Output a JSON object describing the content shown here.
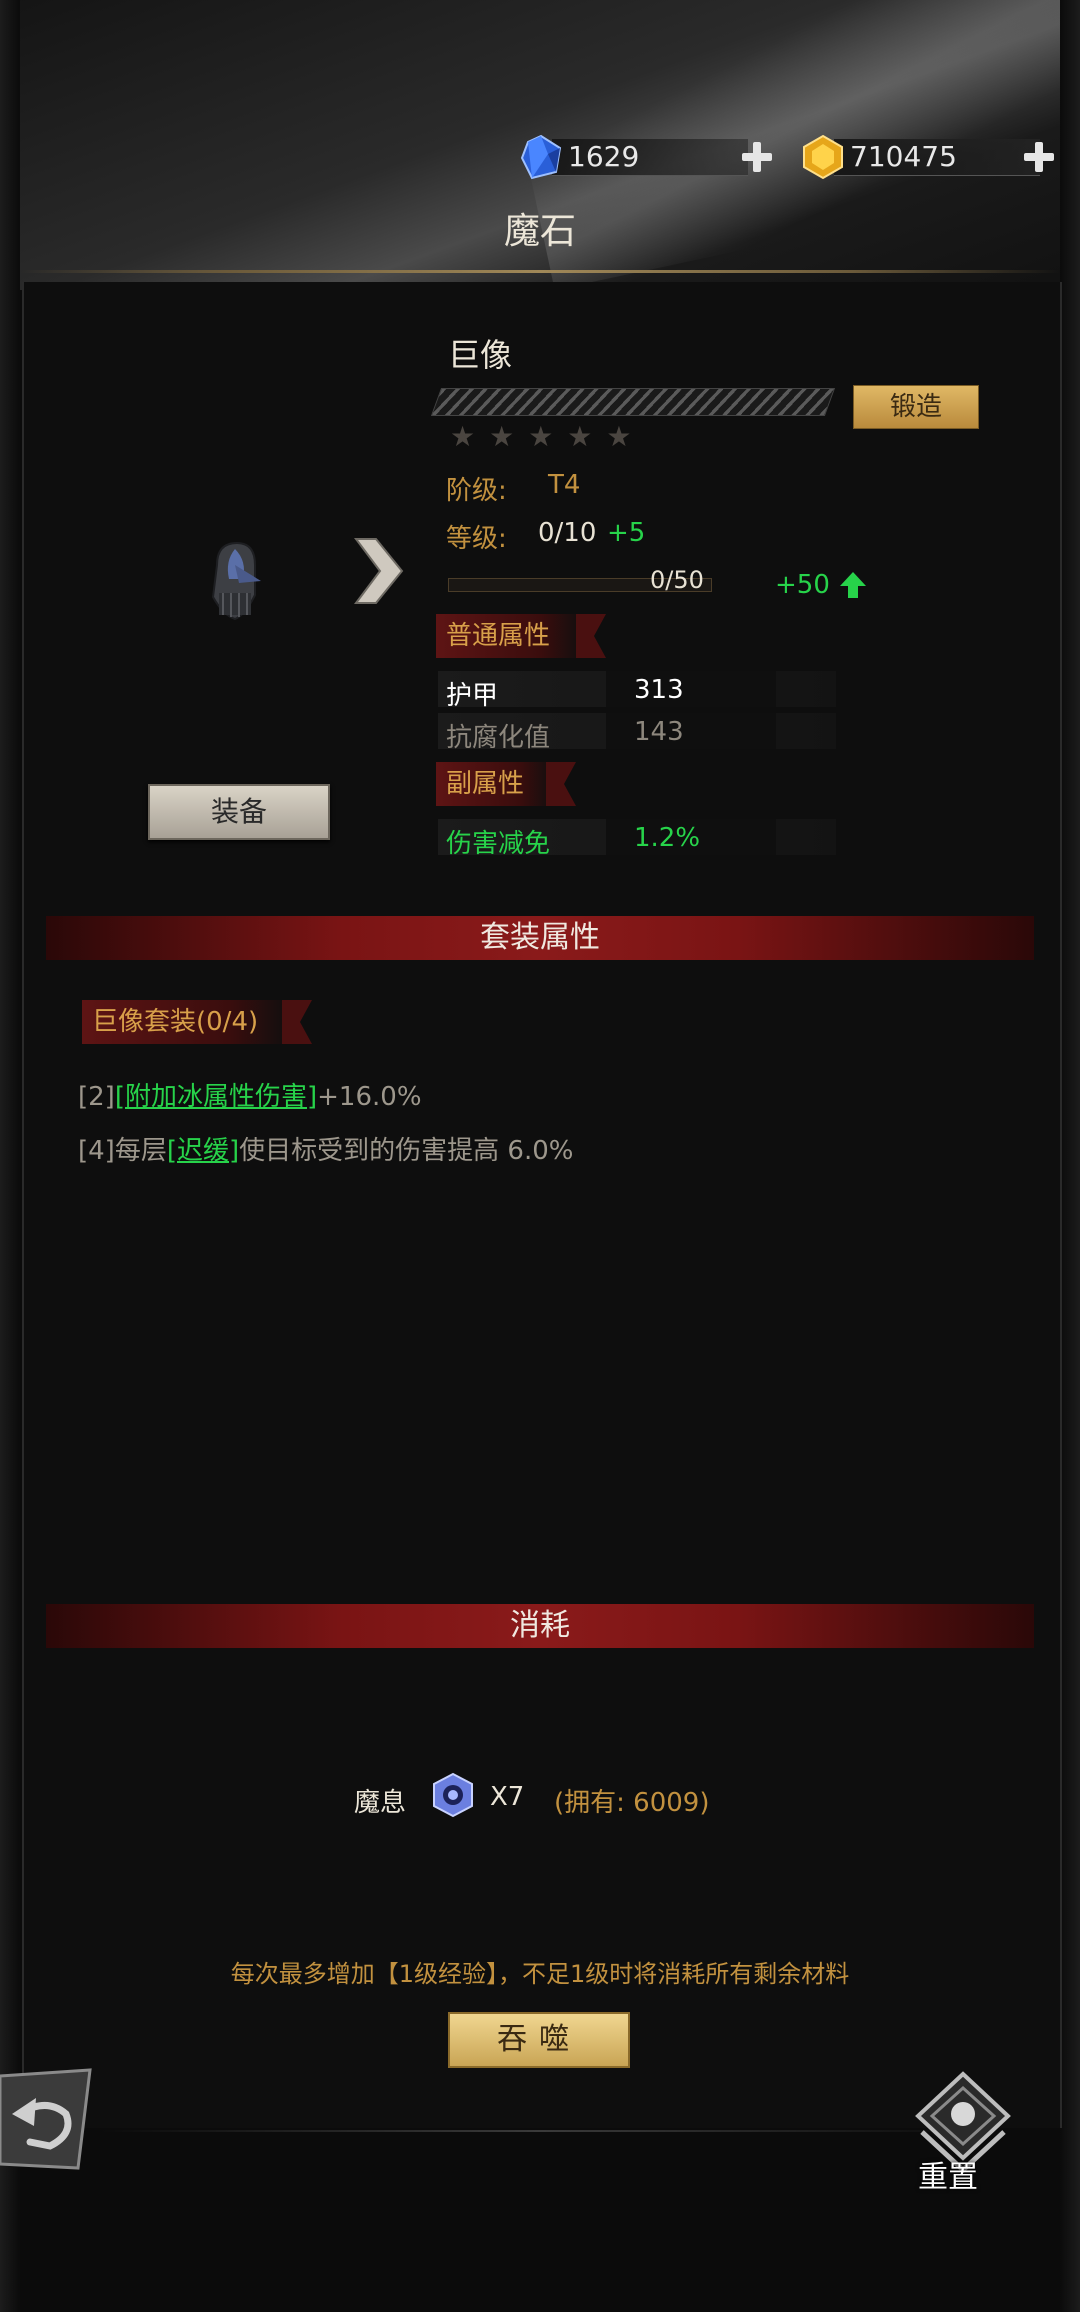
{
  "currency": {
    "gems": "1629",
    "gold": "710475"
  },
  "header": {
    "title": "魔石"
  },
  "item": {
    "name": "巨像",
    "forge_label": "锻造",
    "stars": "★★★★★",
    "tier_label": "阶级:",
    "tier_value": "T4",
    "level_label": "等级:",
    "level_value": "0/10",
    "level_bonus": "+5",
    "exp_text": "0/50",
    "exp_progress": 0,
    "exp_boost": "+50",
    "equip_label": "装备"
  },
  "normal_attrs": {
    "title": "普通属性",
    "rows": [
      {
        "name": "护甲",
        "value": "313"
      },
      {
        "name": "抗腐化值",
        "value": "143"
      }
    ]
  },
  "sub_attrs": {
    "title": "副属性",
    "rows": [
      {
        "name": "伤害减免",
        "value": "1.2%"
      }
    ]
  },
  "set": {
    "section_title": "套装属性",
    "name": "巨像套装(0/4)",
    "effects": [
      {
        "tier": "[2]",
        "link": "[附加冰属性伤害]",
        "text": "+16.0%"
      },
      {
        "tier": "[4]",
        "prefix": "每层",
        "link": "[迟缓]",
        "text": "使目标受到的伤害提高 6.0%"
      }
    ]
  },
  "consume": {
    "section_title": "消耗",
    "material_name": "魔息",
    "quantity": "X7",
    "owned": "(拥有: 6009)",
    "note": "每次最多增加【1级经验】，不足1级时将消耗所有剩余材料",
    "devour_label": "吞噬"
  },
  "footer": {
    "reset_label": "重置"
  },
  "colors": {
    "accent_gold": "#c2913f",
    "green": "#27d34a",
    "ribbon_red": "#7a1414"
  }
}
